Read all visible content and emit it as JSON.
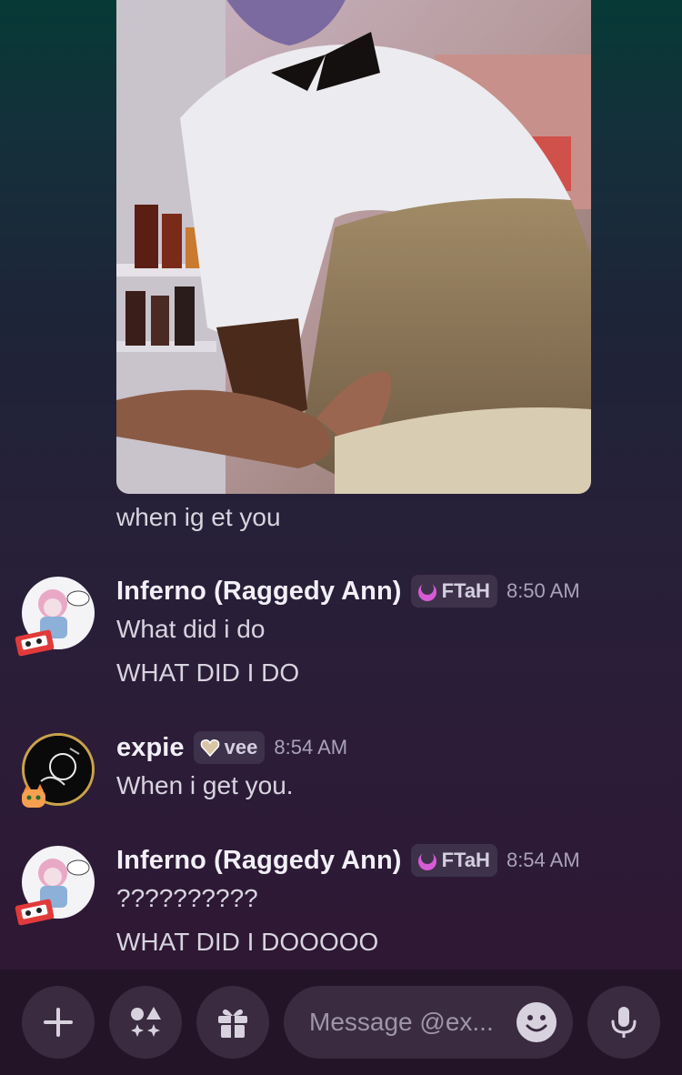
{
  "messages_area": {
    "attachment_caption": "when ig et you"
  },
  "messages": [
    {
      "username": "Inferno (Raggedy Ann)",
      "tag": "FTaH",
      "tag_icon": "pink-crescent-icon",
      "time": "8:50 AM",
      "lines": [
        "What did i do",
        "WHAT DID I DO"
      ]
    },
    {
      "username": "expie",
      "tag": "vee",
      "tag_icon": "heart-badge-icon",
      "time": "8:54 AM",
      "lines": [
        "When i get you."
      ]
    },
    {
      "username": "Inferno (Raggedy Ann)",
      "tag": "FTaH",
      "tag_icon": "pink-crescent-icon",
      "time": "8:54 AM",
      "lines": [
        "??????????",
        "WHAT DID I DOOOOO"
      ]
    }
  ],
  "composer": {
    "placeholder": "Message @ex...",
    "buttons": [
      "plus-icon",
      "apps-icon",
      "gift-icon",
      "emoji-icon",
      "microphone-icon"
    ]
  },
  "colors": {
    "accent_tag": "#3d3249",
    "text": "#d7d4df",
    "username": "#f2f0f7"
  }
}
